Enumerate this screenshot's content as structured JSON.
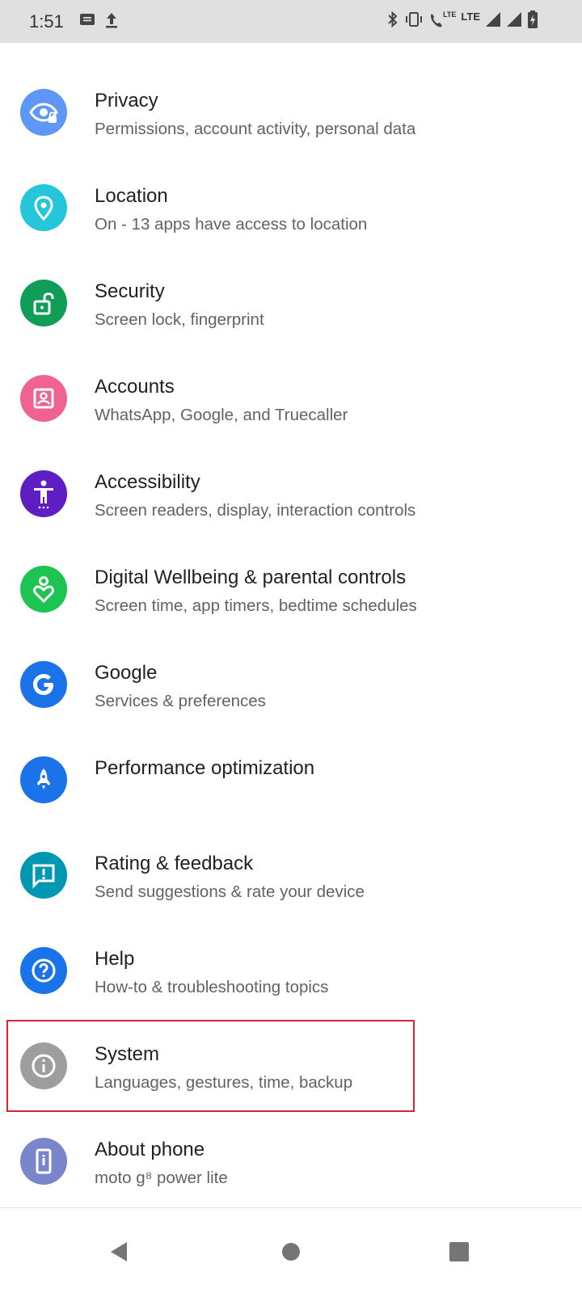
{
  "status_bar": {
    "time": "1:51",
    "lte_small": "LTE",
    "lte_large": "LTE"
  },
  "settings": {
    "items": [
      {
        "title": "Privacy",
        "subtitle": "Permissions, account activity, personal data",
        "icon": "privacy-eye-icon",
        "color": "#5e97f6"
      },
      {
        "title": "Location",
        "subtitle": "On - 13 apps have access to location",
        "icon": "location-pin-icon",
        "color": "#26c6da"
      },
      {
        "title": "Security",
        "subtitle": "Screen lock, fingerprint",
        "icon": "unlock-icon",
        "color": "#0f9d58"
      },
      {
        "title": "Accounts",
        "subtitle": "WhatsApp, Google, and Truecaller",
        "icon": "account-box-icon",
        "color": "#f06292"
      },
      {
        "title": "Accessibility",
        "subtitle": "Screen readers, display, interaction controls",
        "icon": "accessibility-icon",
        "color": "#5e1ec4"
      },
      {
        "title": "Digital Wellbeing & parental controls",
        "subtitle": "Screen time, app timers, bedtime schedules",
        "icon": "wellbeing-heart-icon",
        "color": "#1ec451"
      },
      {
        "title": "Google",
        "subtitle": "Services & preferences",
        "icon": "google-g-icon",
        "color": "#1a73e8"
      },
      {
        "title": "Performance optimization",
        "subtitle": "",
        "icon": "rocket-icon",
        "color": "#1a73e8"
      },
      {
        "title": "Rating & feedback",
        "subtitle": "Send suggestions & rate your device",
        "icon": "feedback-icon",
        "color": "#0097b2"
      },
      {
        "title": "Help",
        "subtitle": "How-to & troubleshooting topics",
        "icon": "help-icon",
        "color": "#1a73e8"
      },
      {
        "title": "System",
        "subtitle": "Languages, gestures, time, backup",
        "icon": "info-icon",
        "color": "#9e9e9e"
      },
      {
        "title": "About phone",
        "subtitle": "moto g⁸ power lite",
        "icon": "phone-icon",
        "color": "#7986cb"
      }
    ]
  },
  "nav": {
    "back": "back-icon",
    "home": "home-icon",
    "recents": "recents-icon"
  }
}
